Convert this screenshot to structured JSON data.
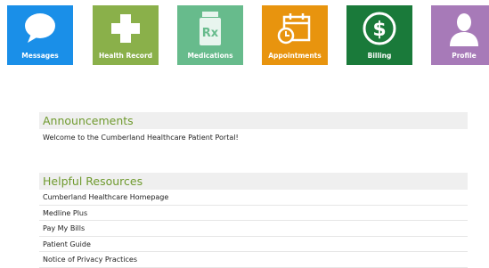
{
  "tiles": [
    {
      "label": "Messages",
      "icon": "speech-bubble-icon",
      "color": "#1a8fe8"
    },
    {
      "label": "Health Record",
      "icon": "medical-cross-icon",
      "color": "#8ab04a"
    },
    {
      "label": "Medications",
      "icon": "prescription-bottle-icon",
      "color": "#67bb8c"
    },
    {
      "label": "Appointments",
      "icon": "calendar-clock-icon",
      "color": "#e8940e"
    },
    {
      "label": "Billing",
      "icon": "dollar-icon",
      "color": "#1a7a3a"
    },
    {
      "label": "Profile",
      "icon": "person-icon",
      "color": "#a77ab8"
    }
  ],
  "rx_symbol": "Rx",
  "announcements": {
    "title": "Announcements",
    "text": "Welcome to the Cumberland Healthcare Patient Portal!"
  },
  "resources": {
    "title": "Helpful Resources",
    "items": [
      "Cumberland Healthcare Homepage",
      "Medline Plus",
      "Pay My Bills",
      "Patient Guide",
      "Notice of Privacy Practices"
    ]
  },
  "section_title_color": "#6f9a2e"
}
